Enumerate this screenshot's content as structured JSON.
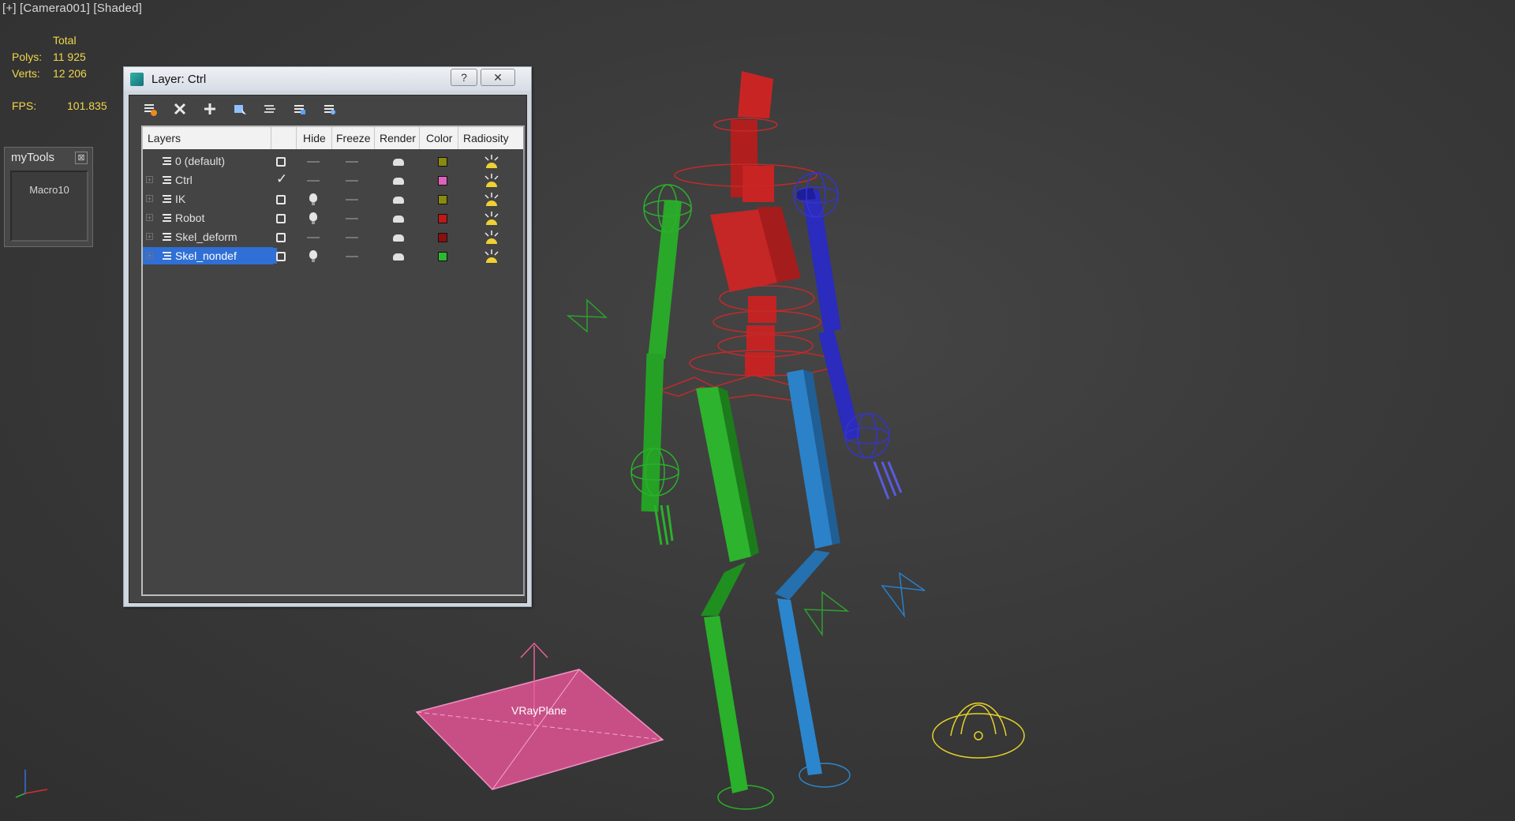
{
  "viewport": {
    "label": "[+] [Camera001] [Shaded]"
  },
  "stats": {
    "total_label": "Total",
    "polys_label": "Polys:",
    "polys_value": "11 925",
    "verts_label": "Verts:",
    "verts_value": "12 206",
    "fps_label": "FPS:",
    "fps_value": "101.835"
  },
  "mytools": {
    "title": "myTools",
    "close_glyph": "⊠",
    "macro_label": "Macro10"
  },
  "layer_dialog": {
    "title": "Layer: Ctrl",
    "help_glyph": "?",
    "close_glyph": "✕",
    "toolbar": [
      "create-new-layer",
      "delete-layer",
      "add-selection-to-layer",
      "select-objects-in-layer",
      "highlight-selected-layer",
      "hide-unhide-all",
      "freeze-unfreeze-all"
    ],
    "columns": [
      "Layers",
      "Hide",
      "Freeze",
      "Render",
      "Color",
      "Radiosity"
    ],
    "layers": [
      {
        "name": "0 (default)",
        "active": false,
        "hidden": false,
        "color": "#8a8a10",
        "expandable": false
      },
      {
        "name": "Ctrl",
        "active": true,
        "hidden": false,
        "color": "#e060c0",
        "expandable": true
      },
      {
        "name": "IK",
        "active": false,
        "hidden": true,
        "color": "#8a8a10",
        "expandable": true
      },
      {
        "name": "Robot",
        "active": false,
        "hidden": true,
        "color": "#c01818",
        "expandable": true
      },
      {
        "name": "Skel_deform",
        "active": false,
        "hidden": false,
        "color": "#8a1010",
        "expandable": true
      },
      {
        "name": "Skel_nondef",
        "active": false,
        "hidden": true,
        "color": "#2eb82e",
        "expandable": true,
        "selected": true
      }
    ]
  },
  "scene": {
    "vray_plane_label": "VRayPlane",
    "colors": {
      "spine": "#d42a2a",
      "left": "#2ab02a",
      "right_arm": "#2b2bbd",
      "right_leg": "#2c82c9",
      "plane": "#d0508a",
      "light": "#e6d22a"
    }
  }
}
